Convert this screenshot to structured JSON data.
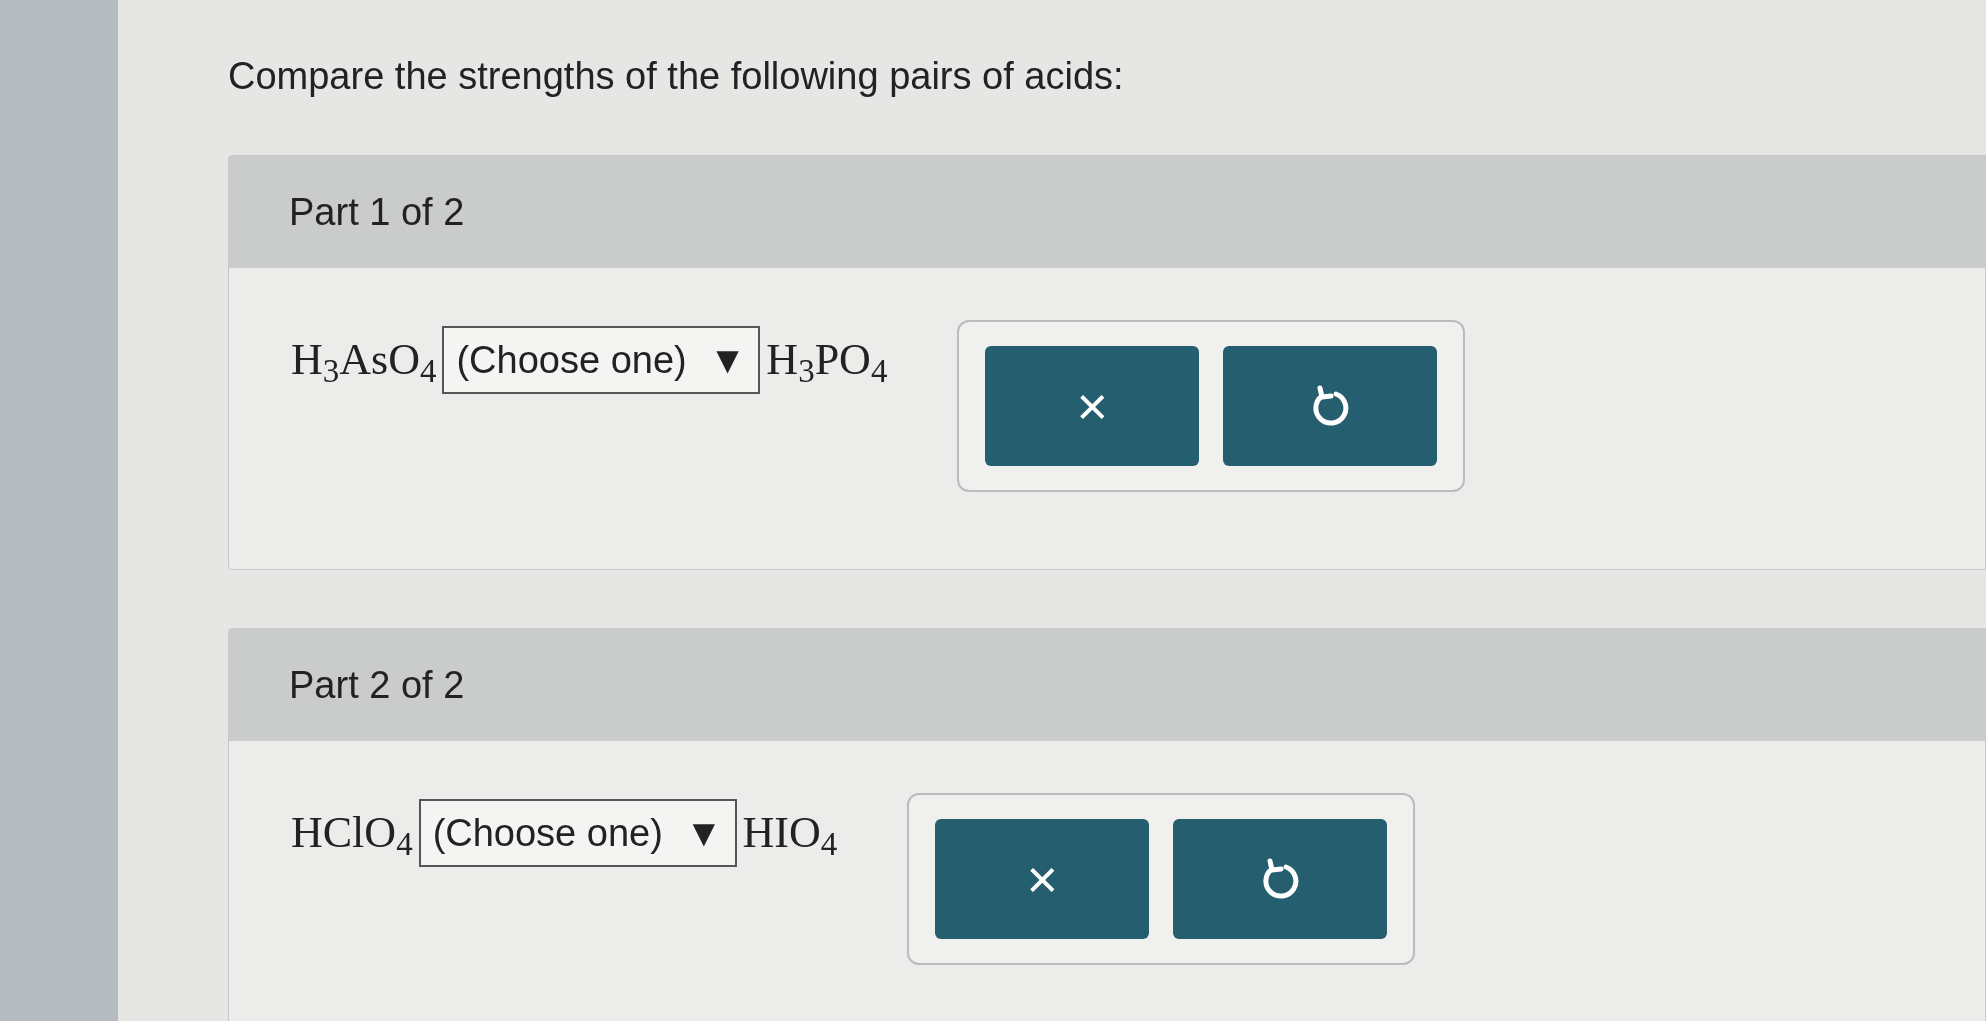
{
  "prompt": "Compare the strengths of the following pairs of acids:",
  "parts": [
    {
      "title": "Part 1 of 2",
      "left": "H$_{3}$AsO$_{4}$",
      "select": {
        "value": "(Choose one)",
        "arrow": "▼"
      },
      "right": "H$_{3}$PO$_{4}$",
      "buttons": [
        {
          "kind": "clear",
          "label": "×"
        },
        {
          "kind": "undo"
        }
      ]
    },
    {
      "title": "Part 2 of 2",
      "left": "HClO$_{4}$",
      "select": {
        "value": "(Choose one)",
        "arrow": "▼"
      },
      "right": "HIO$_{4}$",
      "buttons": [
        {
          "kind": "clear",
          "label": "×"
        },
        {
          "kind": "undo"
        }
      ]
    }
  ]
}
